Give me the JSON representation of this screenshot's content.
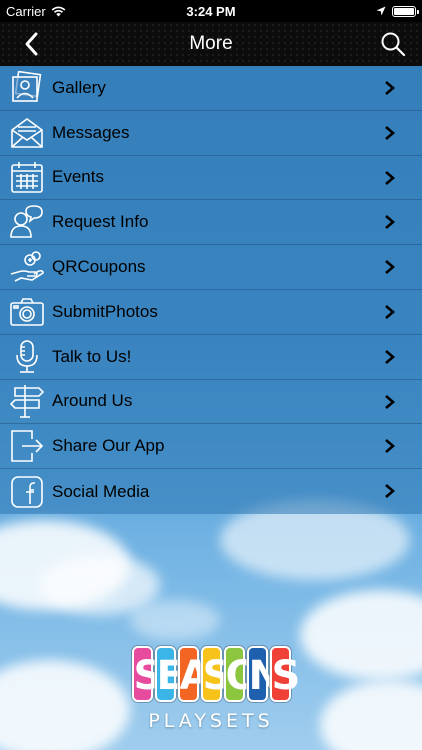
{
  "status_bar": {
    "carrier": "Carrier",
    "time": "3:24 PM"
  },
  "nav": {
    "title": "More",
    "back_icon": "chevron-left-icon",
    "search_icon": "search-icon"
  },
  "menu": {
    "items": [
      {
        "label": "Gallery",
        "icon": "gallery-icon"
      },
      {
        "label": "Messages",
        "icon": "envelope-icon"
      },
      {
        "label": "Events",
        "icon": "calendar-icon"
      },
      {
        "label": "Request Info",
        "icon": "person-speech-icon"
      },
      {
        "label": "QRCoupons",
        "icon": "hand-coupon-icon"
      },
      {
        "label": "SubmitPhotos",
        "icon": "camera-icon"
      },
      {
        "label": "Talk to Us!",
        "icon": "microphone-icon"
      },
      {
        "label": "Around Us",
        "icon": "signpost-icon"
      },
      {
        "label": "Share Our App",
        "icon": "share-exit-icon"
      },
      {
        "label": "Social Media",
        "icon": "facebook-icon"
      }
    ]
  },
  "logo": {
    "letters": [
      "S",
      "E",
      "A",
      "S",
      "O",
      "N",
      "S"
    ],
    "letter_colors": [
      "#e64b9e",
      "#3bb4e8",
      "#f26522",
      "#f7c21a",
      "#8cc63f",
      "#1e5fae",
      "#ef4136"
    ],
    "subtitle": "PLAYSETS"
  },
  "colors": {
    "nav_background": "#0c0c0c",
    "menu_overlay": "#2c76b2",
    "text": "#000000"
  }
}
